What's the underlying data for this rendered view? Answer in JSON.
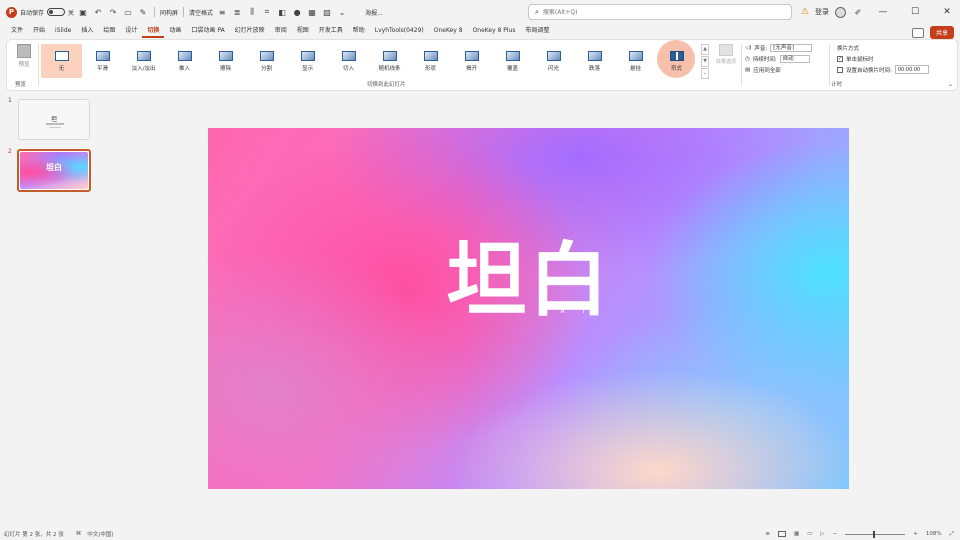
{
  "colors": {
    "accent": "#c43e1c",
    "selected_bg": "#fcd2be",
    "ribbon_bg": "#ffffff"
  },
  "titlebar": {
    "autosave_label": "自动保存",
    "autosave_state": "关",
    "quick_access_text": "同构屏",
    "quick_access_text2": "清空格式",
    "doc_title": "海报...",
    "search_placeholder": "搜索(Alt+Q)",
    "user_label": "登录",
    "minimize": "—",
    "maximize": "☐",
    "close": "✕"
  },
  "menu": {
    "tabs": [
      "文件",
      "开始",
      "iSlide",
      "插入",
      "绘图",
      "设计",
      "切换",
      "动画",
      "口袋动画 PA",
      "幻灯片放映",
      "审阅",
      "视图",
      "开发工具",
      "帮助",
      "LvyhTools(0429)",
      "OneKey 8",
      "OneKey 8 Plus",
      "布局调整"
    ],
    "active_tab": "切换",
    "share_label": "共享"
  },
  "ribbon": {
    "preview_label": "预览",
    "preview_group": "预览",
    "gallery_group": "切换到此幻灯片",
    "transitions": [
      {
        "label": "无",
        "selected": true
      },
      {
        "label": "平滑"
      },
      {
        "label": "淡入/淡出"
      },
      {
        "label": "推入"
      },
      {
        "label": "擦除"
      },
      {
        "label": "分割"
      },
      {
        "label": "显示"
      },
      {
        "label": "切入"
      },
      {
        "label": "随机线条"
      },
      {
        "label": "形状"
      },
      {
        "label": "揭开"
      },
      {
        "label": "覆盖"
      },
      {
        "label": "闪光"
      },
      {
        "label": "跌落"
      },
      {
        "label": "悬挂"
      },
      {
        "label": "帘式"
      }
    ],
    "effect_options_label": "效果选项",
    "timing": {
      "sound_label": "声音:",
      "sound_value": "[无声音]",
      "duration_label": "持续时间:",
      "duration_value": "自动",
      "apply_all_label": "应用到全部"
    },
    "advance": {
      "title": "换片方式",
      "on_click_label": "单击鼠标时",
      "on_click_checked": true,
      "after_label": "设置自动换片时间:",
      "after_value": "00:00.00"
    },
    "timing_group": "计时"
  },
  "slides": [
    {
      "number": "1",
      "title": "坦",
      "active": false
    },
    {
      "number": "2",
      "title": "坦白",
      "active": true
    }
  ],
  "slide": {
    "title": "坦白",
    "subtitle": "TANBAI"
  },
  "status": {
    "slide_info": "幻灯片 第 2 张，共 2 张",
    "language": "中文(中国)",
    "zoom": "108%"
  }
}
